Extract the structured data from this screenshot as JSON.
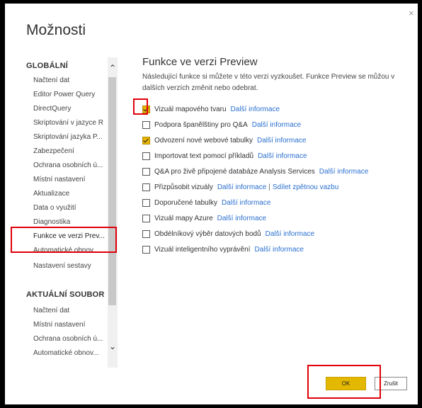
{
  "dialog": {
    "title": "Možnosti",
    "close_glyph": "×"
  },
  "sidebar": {
    "global_header": "GLOBÁLNÍ",
    "global_items": [
      "Načtení dat",
      "Editor Power Query",
      "DirectQuery",
      "Skriptování v jazyce R",
      "Skriptování jazyka P...",
      "Zabezpečení",
      "Ochrana osobních ú...",
      "Místní nastavení",
      "Aktualizace",
      "Data o využití",
      "Diagnostika",
      "Funkce ve verzi Prev...",
      "Automatické obnov...",
      "Nastavení sestavy"
    ],
    "current_header": "AKTUÁLNÍ SOUBOR",
    "current_items": [
      "Načtení dat",
      "Místní nastavení",
      "Ochrana osobních ú...",
      "Automatické obnov..."
    ],
    "scroll_up_glyph": "⌃",
    "scroll_down_glyph": "⌄"
  },
  "main": {
    "title": "Funkce ve verzi Preview",
    "description": "Následující funkce si můžete v této verzi vyzkoušet. Funkce Preview se můžou v dalších verzích změnit nebo odebrat.",
    "options": [
      {
        "label": "Vizuál mapového tvaru",
        "checked": true,
        "link": "Další informace"
      },
      {
        "label": "Podpora španělštiny pro Q&A",
        "checked": false,
        "link": "Další informace"
      },
      {
        "label": "Odvození nové webové tabulky",
        "checked": true,
        "link": "Další informace"
      },
      {
        "label": "Importovat text pomocí příkladů",
        "checked": false,
        "link": "Další informace"
      },
      {
        "label": "Q&A pro živě připojené databáze Analysis Services",
        "checked": false,
        "link": "Další informace"
      },
      {
        "label": "Přizpůsobit vizuály",
        "checked": false,
        "link": "Další informace",
        "separator": "|",
        "link2": "Sdílet zpětnou vazbu"
      },
      {
        "label": "Doporučené tabulky",
        "checked": false,
        "link": "Další informace"
      },
      {
        "label": "Vizuál mapy Azure",
        "checked": false,
        "link": "Další informace"
      },
      {
        "label": "Obdélníkový výběr datových bodů",
        "checked": false,
        "link": "Další informace"
      },
      {
        "label": "Vizuál inteligentního vyprávění",
        "checked": false,
        "link": "Další informace"
      }
    ]
  },
  "buttons": {
    "ok": "OK",
    "cancel": "Zrušit"
  },
  "colors": {
    "highlight": "#e0000a",
    "accent": "#e3b800",
    "link": "#2a6fcf"
  }
}
